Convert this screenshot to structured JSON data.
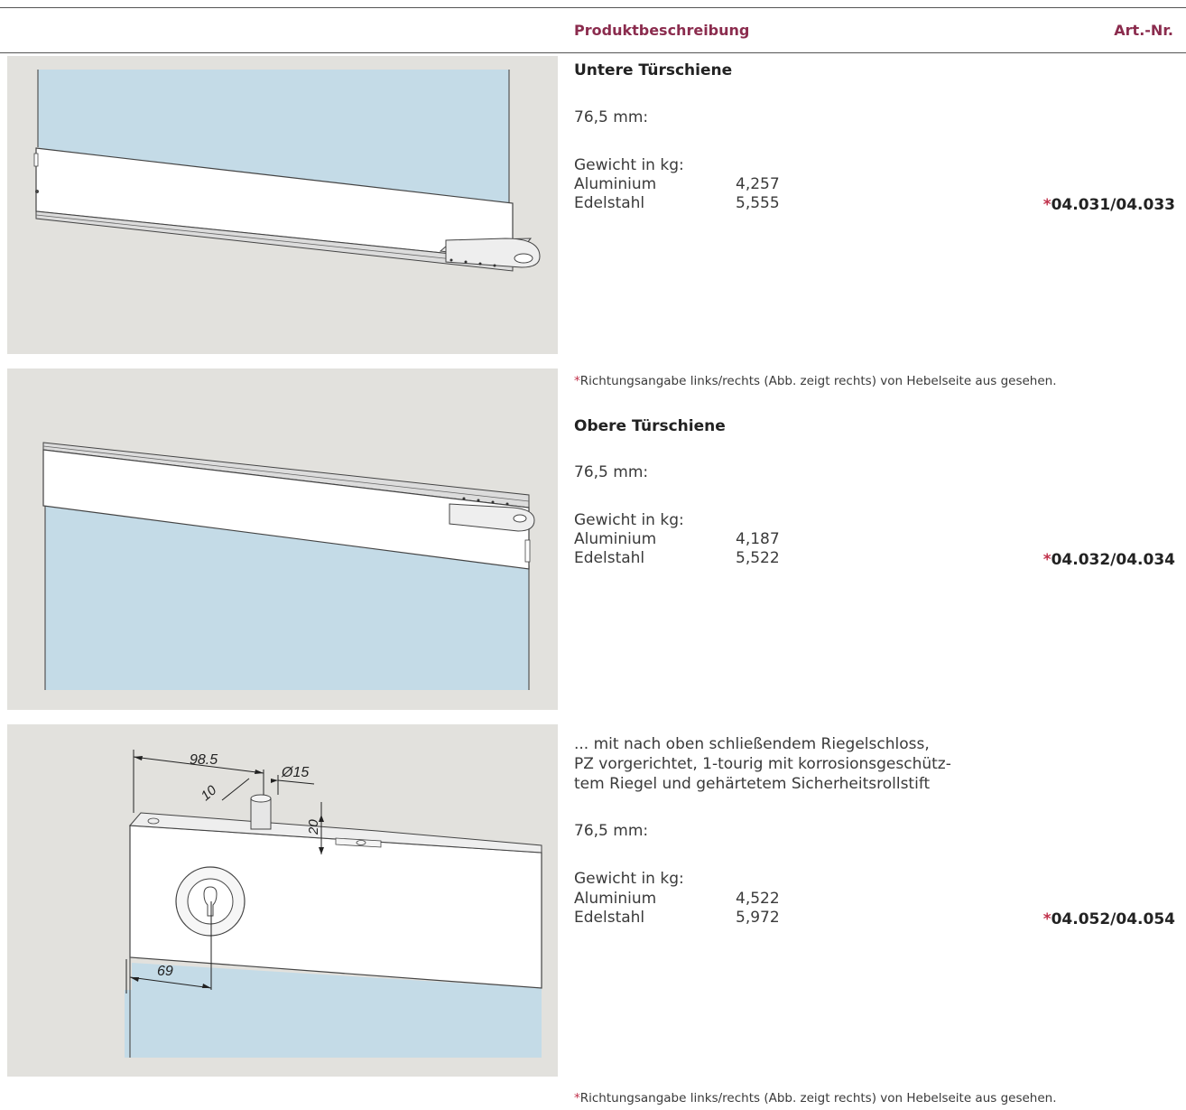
{
  "header": {
    "description_label": "Produktbeschreibung",
    "article_label": "Art.-Nr."
  },
  "products": [
    {
      "title": "Untere Türschiene",
      "dimension": "76,5 mm:",
      "weight_label": "Gewicht in kg:",
      "materials": [
        {
          "name": "Aluminium",
          "value": "4,257"
        },
        {
          "name": "Edelstahl",
          "value": "5,555"
        }
      ],
      "article_star": "*",
      "article_number": "04.031/04.033"
    },
    {
      "title": "Obere Türschiene",
      "dimension": "76,5 mm:",
      "weight_label": "Gewicht in kg:",
      "materials": [
        {
          "name": "Aluminium",
          "value": "4,187"
        },
        {
          "name": "Edelstahl",
          "value": "5,522"
        }
      ],
      "article_star": "*",
      "article_number": "04.032/04.034"
    },
    {
      "description_lines": [
        "... mit nach oben schließendem Riegelschloss,",
        "PZ vorgerichtet, 1-tourig mit korrosionsgeschütz-",
        "tem Riegel und gehärtetem Sicherheitsrollstift"
      ],
      "dimension": "76,5 mm:",
      "weight_label": "Gewicht in kg:",
      "materials": [
        {
          "name": "Aluminium",
          "value": "4,522"
        },
        {
          "name": "Edelstahl",
          "value": "5,972"
        }
      ],
      "article_star": "*",
      "article_number": "04.052/04.054"
    }
  ],
  "footnote": {
    "star": "*",
    "text": "Richtungsangabe links/rechts (Abb. zeigt rechts) von Hebelseite aus gesehen."
  },
  "drawing_dimensions": {
    "length": "98.5",
    "diameter": "Ø15",
    "pin_offset": "10",
    "pin_height": "20",
    "lock_offset": "69"
  },
  "colors": {
    "accent": "#8b2c4e",
    "star": "#c0304a",
    "panel_bg": "#e2e1dd",
    "glass": "#c4dbe7"
  }
}
